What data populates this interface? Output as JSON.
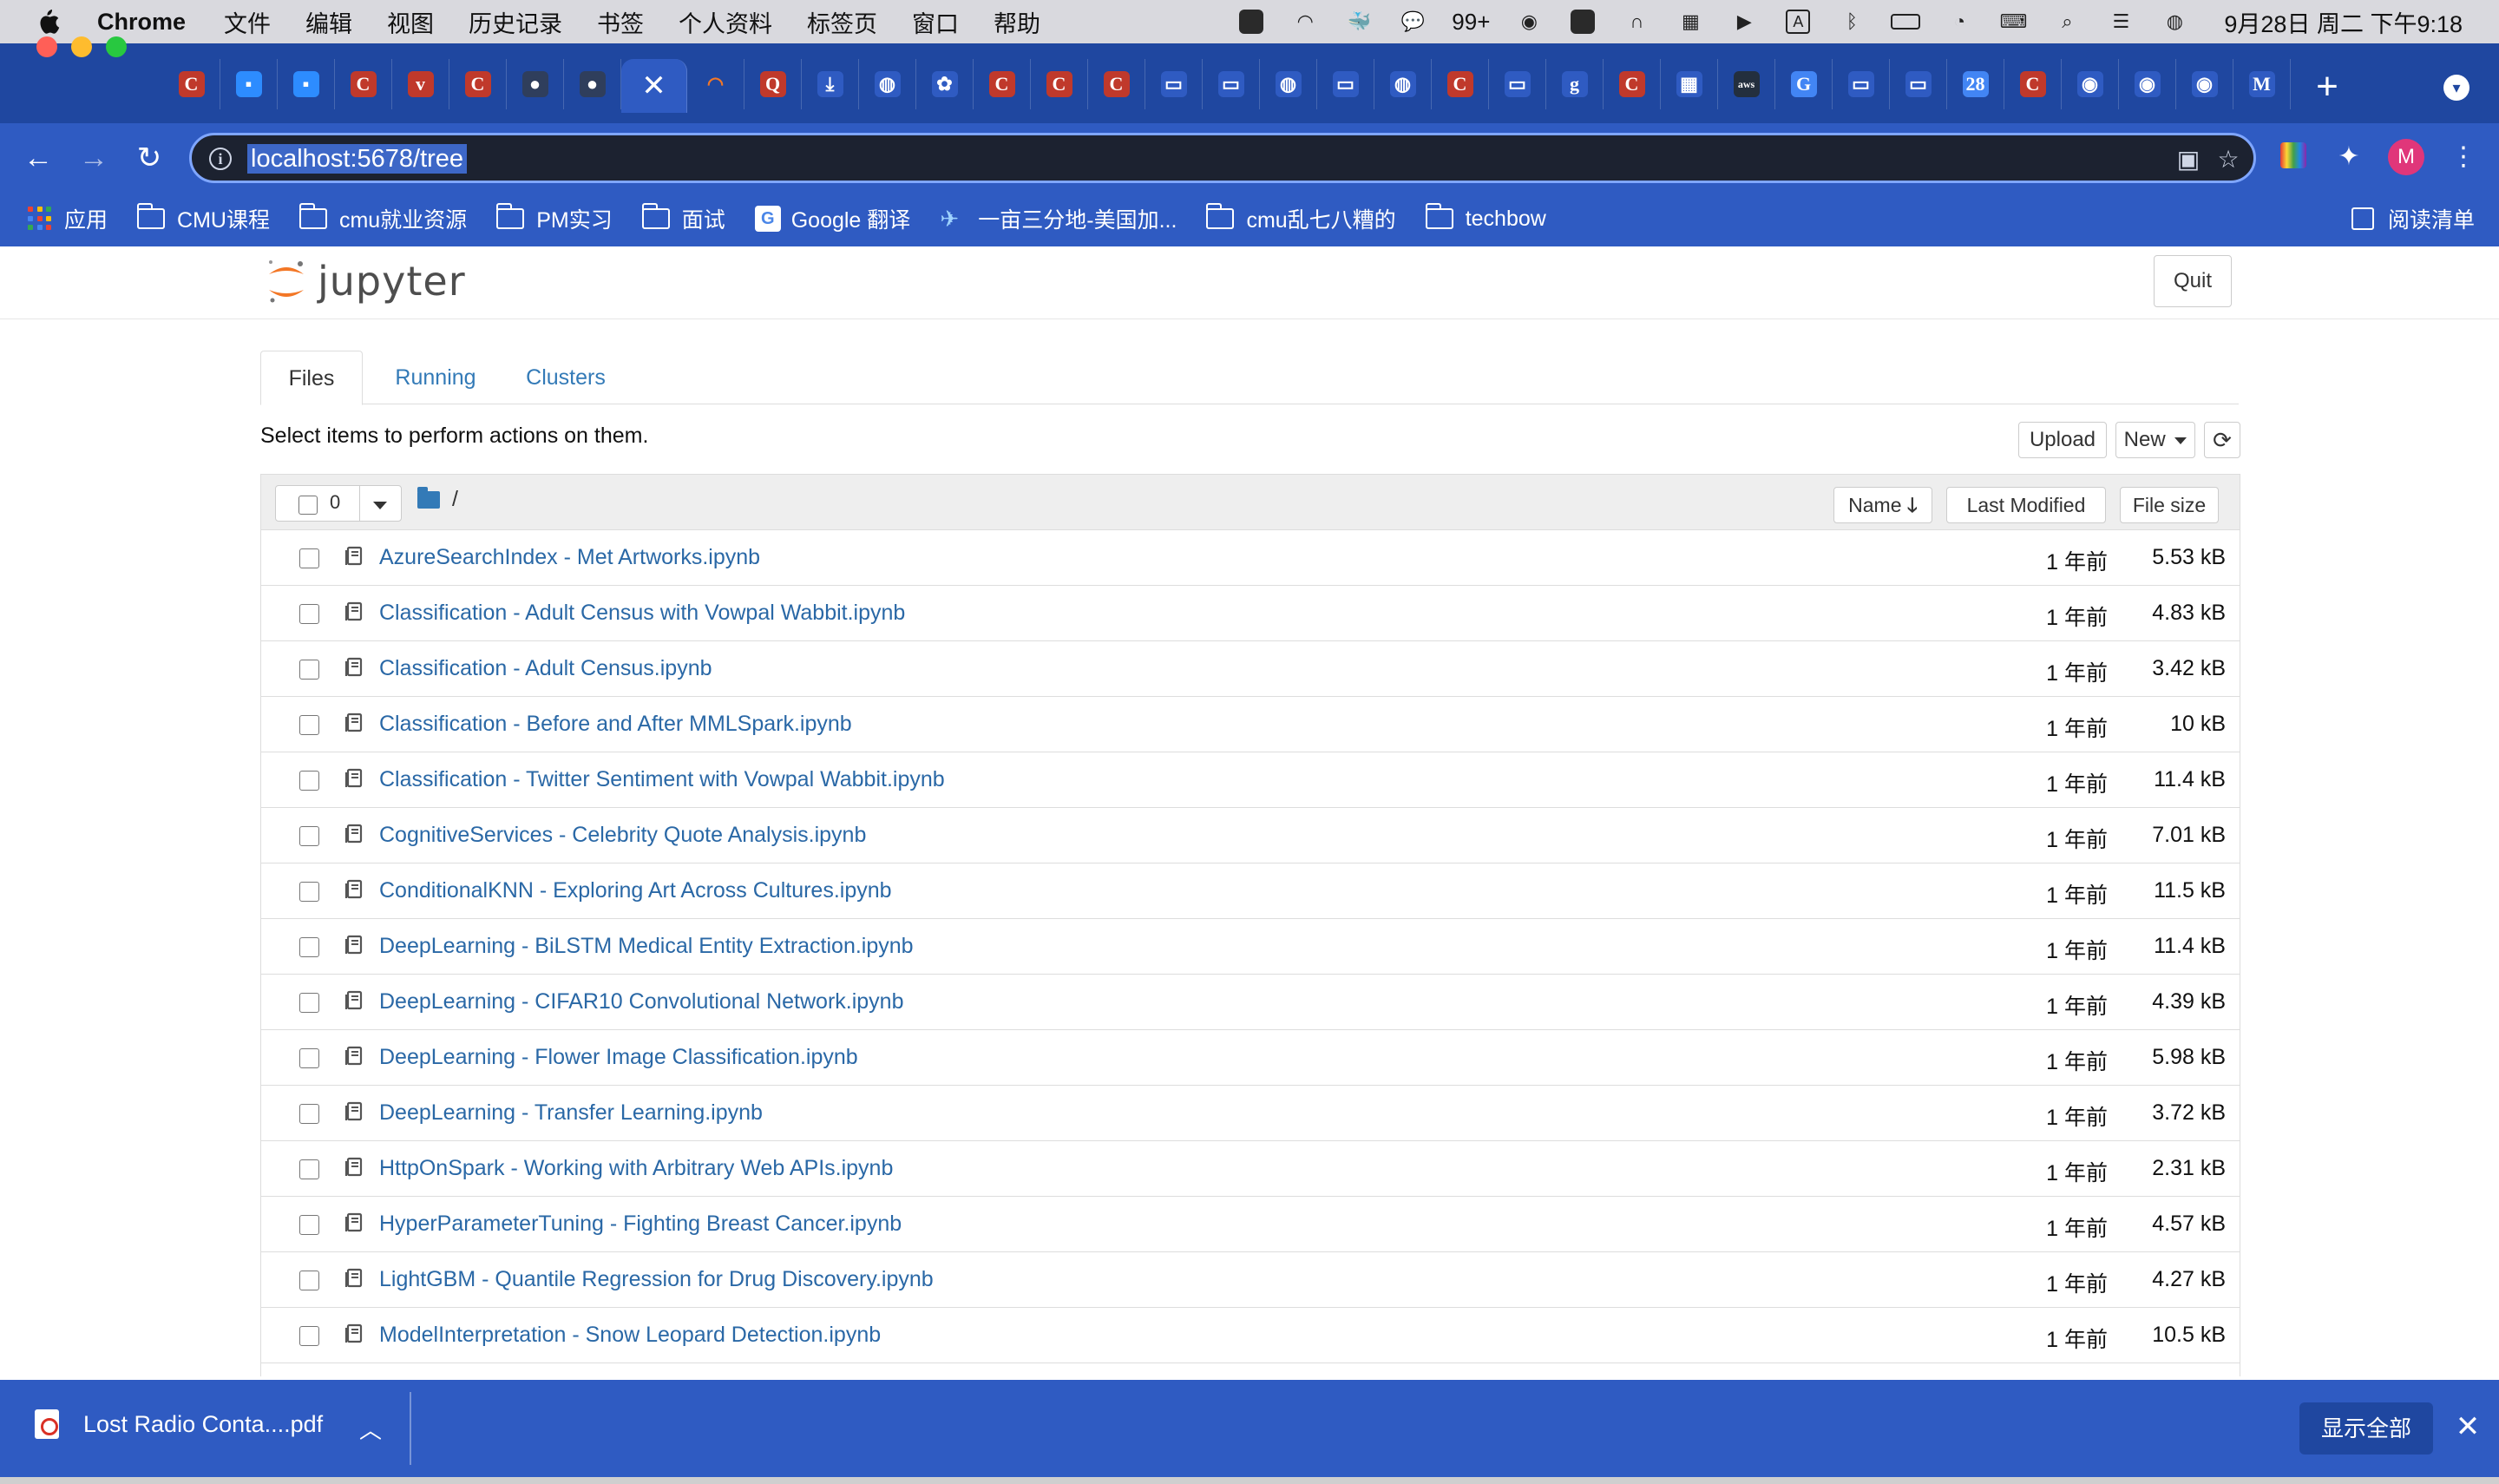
{
  "menubar": {
    "app_name": "Chrome",
    "items": [
      "文件",
      "编辑",
      "视图",
      "历史记录",
      "书签",
      "个人资料",
      "标签页",
      "窗口",
      "帮助"
    ],
    "wechat_badge": "99+",
    "input_method": "A",
    "clock": "9月28日 周二 下午9:18"
  },
  "browser": {
    "active_tab_icon": "close-icon",
    "url": "localhost:5678/tree",
    "profile_initial": "M",
    "tab_favicons": [
      "C",
      "zoom",
      "zoom",
      "C",
      "v",
      "C",
      "gh",
      "gh",
      "x",
      "jupyter",
      "Q",
      "download",
      "globe",
      "baidu",
      "C",
      "C",
      "C",
      "folder",
      "folder",
      "globe",
      "folder",
      "globe",
      "C",
      "folder",
      "g",
      "C",
      "ms",
      "aws",
      "translate",
      "folder",
      "folder",
      "28",
      "C",
      "weibo",
      "weibo",
      "weibo",
      "gmail"
    ]
  },
  "bookmarks": {
    "items": [
      {
        "label": "应用",
        "icon": "apps-icon"
      },
      {
        "label": "CMU课程",
        "icon": "folder-icon"
      },
      {
        "label": "cmu就业资源",
        "icon": "folder-icon"
      },
      {
        "label": "PM实习",
        "icon": "folder-icon"
      },
      {
        "label": "面试",
        "icon": "folder-icon"
      },
      {
        "label": "Google 翻译",
        "icon": "google-translate-icon"
      },
      {
        "label": "一亩三分地-美国加...",
        "icon": "site-icon"
      },
      {
        "label": "cmu乱七八糟的",
        "icon": "folder-icon"
      },
      {
        "label": "techbow",
        "icon": "folder-icon"
      }
    ],
    "reading_list": "阅读清单"
  },
  "jupyter": {
    "logo_text": "jupyter",
    "quit_label": "Quit",
    "tabs": [
      "Files",
      "Running",
      "Clusters"
    ],
    "hint": "Select items to perform actions on them.",
    "upload_label": "Upload",
    "new_label": "New",
    "selected_count": "0",
    "breadcrumb": "/",
    "columns": {
      "name": "Name",
      "modified": "Last Modified",
      "size": "File size"
    },
    "files": [
      {
        "name": "AzureSearchIndex - Met Artworks.ipynb",
        "modified": "1 年前",
        "size": "5.53 kB"
      },
      {
        "name": "Classification - Adult Census with Vowpal Wabbit.ipynb",
        "modified": "1 年前",
        "size": "4.83 kB"
      },
      {
        "name": "Classification - Adult Census.ipynb",
        "modified": "1 年前",
        "size": "3.42 kB"
      },
      {
        "name": "Classification - Before and After MMLSpark.ipynb",
        "modified": "1 年前",
        "size": "10 kB"
      },
      {
        "name": "Classification - Twitter Sentiment with Vowpal Wabbit.ipynb",
        "modified": "1 年前",
        "size": "11.4 kB"
      },
      {
        "name": "CognitiveServices - Celebrity Quote Analysis.ipynb",
        "modified": "1 年前",
        "size": "7.01 kB"
      },
      {
        "name": "ConditionalKNN - Exploring Art Across Cultures.ipynb",
        "modified": "1 年前",
        "size": "11.5 kB"
      },
      {
        "name": "DeepLearning - BiLSTM Medical Entity Extraction.ipynb",
        "modified": "1 年前",
        "size": "11.4 kB"
      },
      {
        "name": "DeepLearning - CIFAR10 Convolutional Network.ipynb",
        "modified": "1 年前",
        "size": "4.39 kB"
      },
      {
        "name": "DeepLearning - Flower Image Classification.ipynb",
        "modified": "1 年前",
        "size": "5.98 kB"
      },
      {
        "name": "DeepLearning - Transfer Learning.ipynb",
        "modified": "1 年前",
        "size": "3.72 kB"
      },
      {
        "name": "HttpOnSpark - Working with Arbitrary Web APIs.ipynb",
        "modified": "1 年前",
        "size": "2.31 kB"
      },
      {
        "name": "HyperParameterTuning - Fighting Breast Cancer.ipynb",
        "modified": "1 年前",
        "size": "4.57 kB"
      },
      {
        "name": "LightGBM - Quantile Regression for Drug Discovery.ipynb",
        "modified": "1 年前",
        "size": "4.27 kB"
      },
      {
        "name": "ModelInterpretation - Snow Leopard Detection.ipynb",
        "modified": "1 年前",
        "size": "10.5 kB"
      }
    ]
  },
  "downloads": {
    "file_name": "Lost Radio Conta....pdf",
    "show_all": "显示全部"
  },
  "colors": {
    "chrome_frame": "#1f47a0",
    "chrome_toolbar": "#2f5bc2",
    "link": "#2a68a6",
    "jupyter_orange": "#f37726"
  }
}
